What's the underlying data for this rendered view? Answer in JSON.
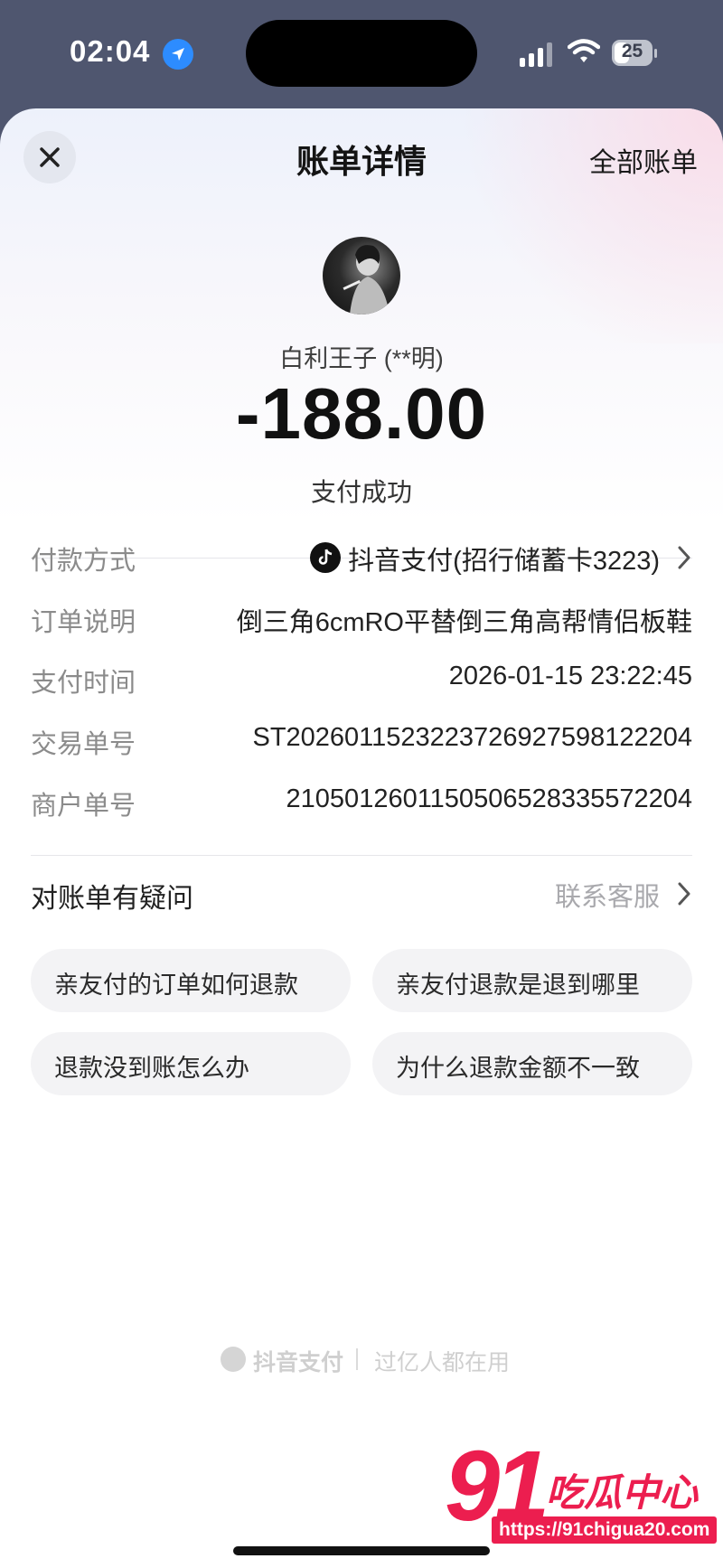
{
  "status_bar": {
    "time": "02:04",
    "battery": "25"
  },
  "header": {
    "title": "账单详情",
    "all_bills": "全部账单"
  },
  "summary": {
    "merchant": "白利王子 (**明)",
    "amount": "-188.00",
    "status": "支付成功"
  },
  "details": [
    {
      "label": "付款方式",
      "value": "抖音支付(招行储蓄卡3223)"
    },
    {
      "label": "订单说明",
      "value": "倒三角6cmRO平替倒三角高帮情侣板鞋"
    },
    {
      "label": "支付时间",
      "value": "2026-01-15 23:22:45"
    },
    {
      "label": "交易单号",
      "value": "ST20260115232237269275981222​04"
    },
    {
      "label": "商户单号",
      "value": "2105012601150506528335572204"
    }
  ],
  "help": {
    "title": "对账单有疑问",
    "contact": "联系客服",
    "faq": [
      "亲友付的订单如何退款",
      "亲友付退款是退到哪里",
      "退款没到账怎么办",
      "为什么退款金额不一致"
    ]
  },
  "footer": {
    "brand": "抖音支付",
    "slogan": "过亿人都在用"
  },
  "watermark": {
    "number": "91",
    "name": "吃瓜中心",
    "url": "https://91chigua20.com"
  },
  "colors": {
    "accent_red": "#ec1e4f",
    "location_blue": "#2d8cff"
  },
  "icons": [
    "location-arrow-icon",
    "signal-icon",
    "wifi-icon",
    "battery-icon",
    "close-icon",
    "douyin-pay-icon",
    "chevron-right-icon"
  ]
}
